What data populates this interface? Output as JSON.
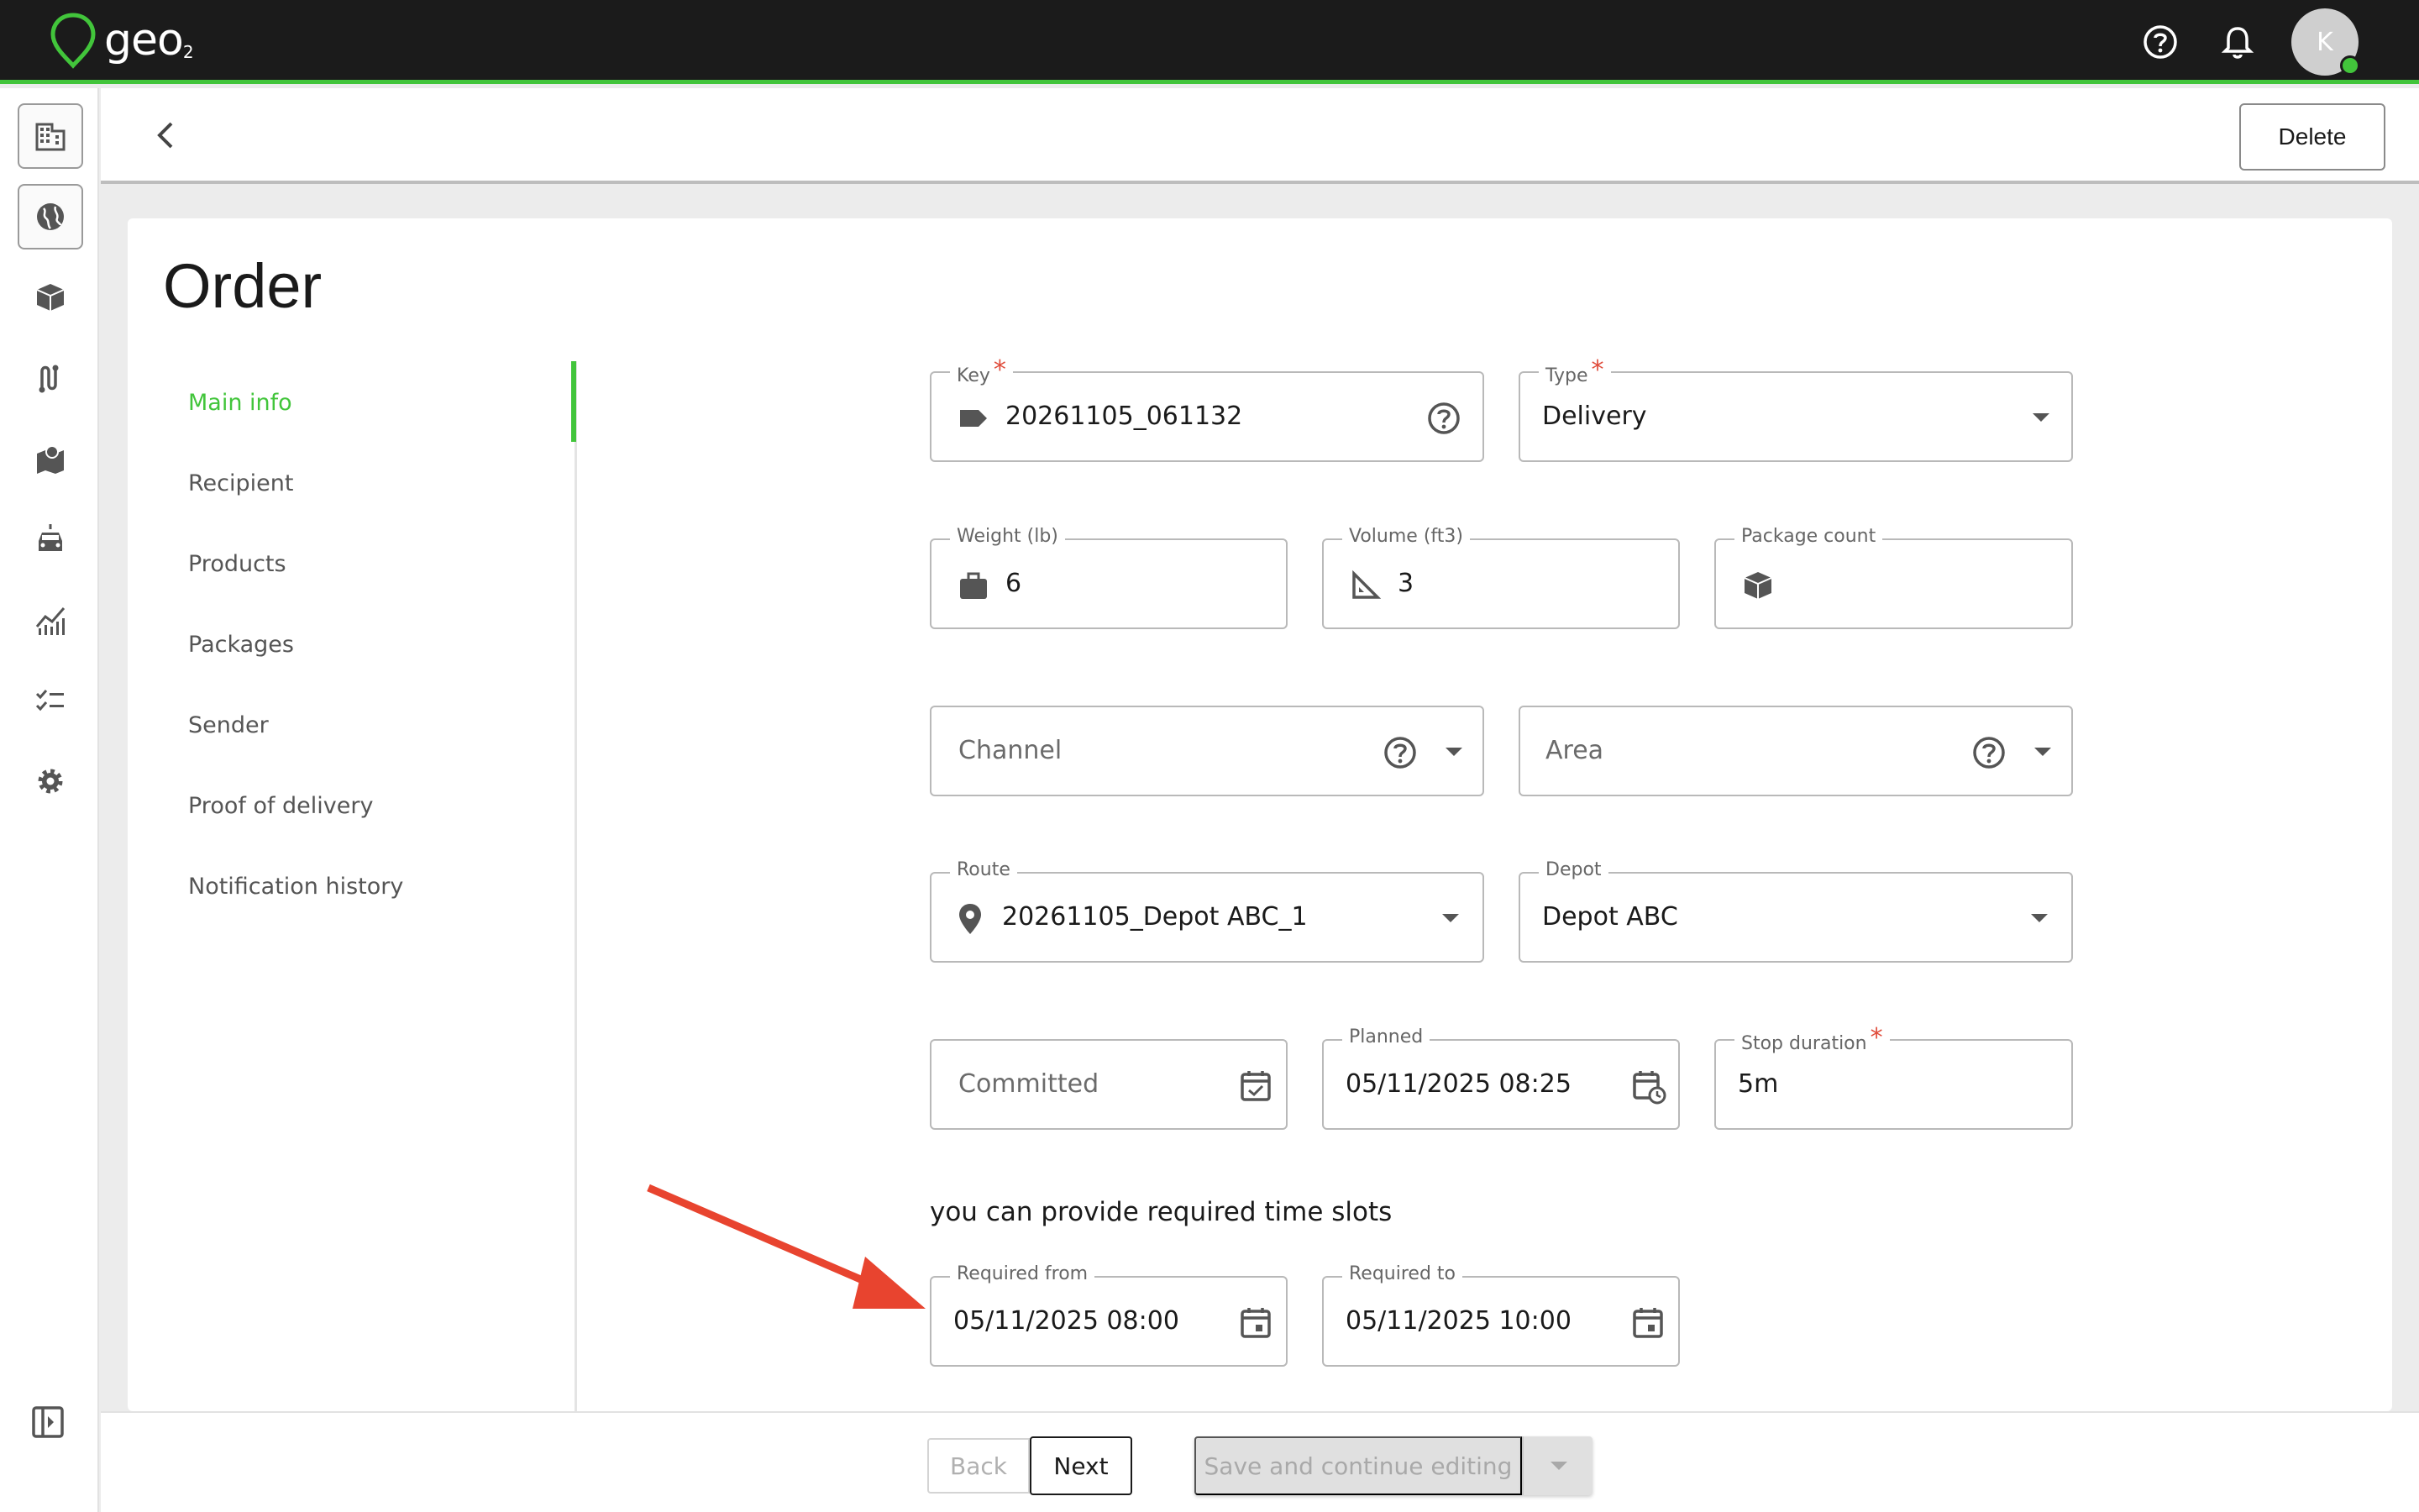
{
  "app": {
    "logo_text": "geo",
    "logo_sub": "2",
    "avatar_initial": "K"
  },
  "colors": {
    "accent": "#42c53b",
    "required": "#e04d3c",
    "topbar": "#1b1b1b",
    "annotation_arrow": "#e8442f"
  },
  "topbar": {
    "icons": [
      "help-circle-icon",
      "bell-icon"
    ]
  },
  "rail": {
    "icons": [
      "building-icon",
      "globe-icon",
      "box-icon",
      "route-icon",
      "map-icon",
      "vehicle-icon",
      "analytics-icon",
      "checklist-icon",
      "gear-icon"
    ],
    "collapse_icon": "sidebar-collapse-icon"
  },
  "header": {
    "delete_label": "Delete"
  },
  "page": {
    "title": "Order"
  },
  "nav": {
    "items": [
      {
        "label": "Main info",
        "active": true
      },
      {
        "label": "Recipient"
      },
      {
        "label": "Products"
      },
      {
        "label": "Packages"
      },
      {
        "label": "Sender"
      },
      {
        "label": "Proof of delivery"
      },
      {
        "label": "Notification history"
      }
    ]
  },
  "form": {
    "key": {
      "label": "Key",
      "value": "20261105_061132"
    },
    "type": {
      "label": "Type",
      "value": "Delivery"
    },
    "weight": {
      "label": "Weight (lb)",
      "value": "6"
    },
    "volume": {
      "label": "Volume (ft3)",
      "value": "3"
    },
    "package_count": {
      "label": "Package count",
      "value": ""
    },
    "channel": {
      "placeholder": "Channel"
    },
    "area": {
      "placeholder": "Area"
    },
    "route": {
      "label": "Route",
      "value": "20261105_Depot ABC_1"
    },
    "depot": {
      "label": "Depot",
      "value": "Depot ABC"
    },
    "committed": {
      "placeholder": "Committed"
    },
    "planned": {
      "label": "Planned",
      "value": "05/11/2025 08:25"
    },
    "stop_duration": {
      "label": "Stop duration",
      "value": "5m"
    },
    "hint": "you can provide required time slots",
    "required_from": {
      "label": "Required from",
      "value": "05/11/2025 08:00"
    },
    "required_to": {
      "label": "Required to",
      "value": "05/11/2025 10:00"
    },
    "required_marker": "*"
  },
  "footer": {
    "back_label": "Back",
    "next_label": "Next",
    "save_label": "Save and continue editing"
  }
}
